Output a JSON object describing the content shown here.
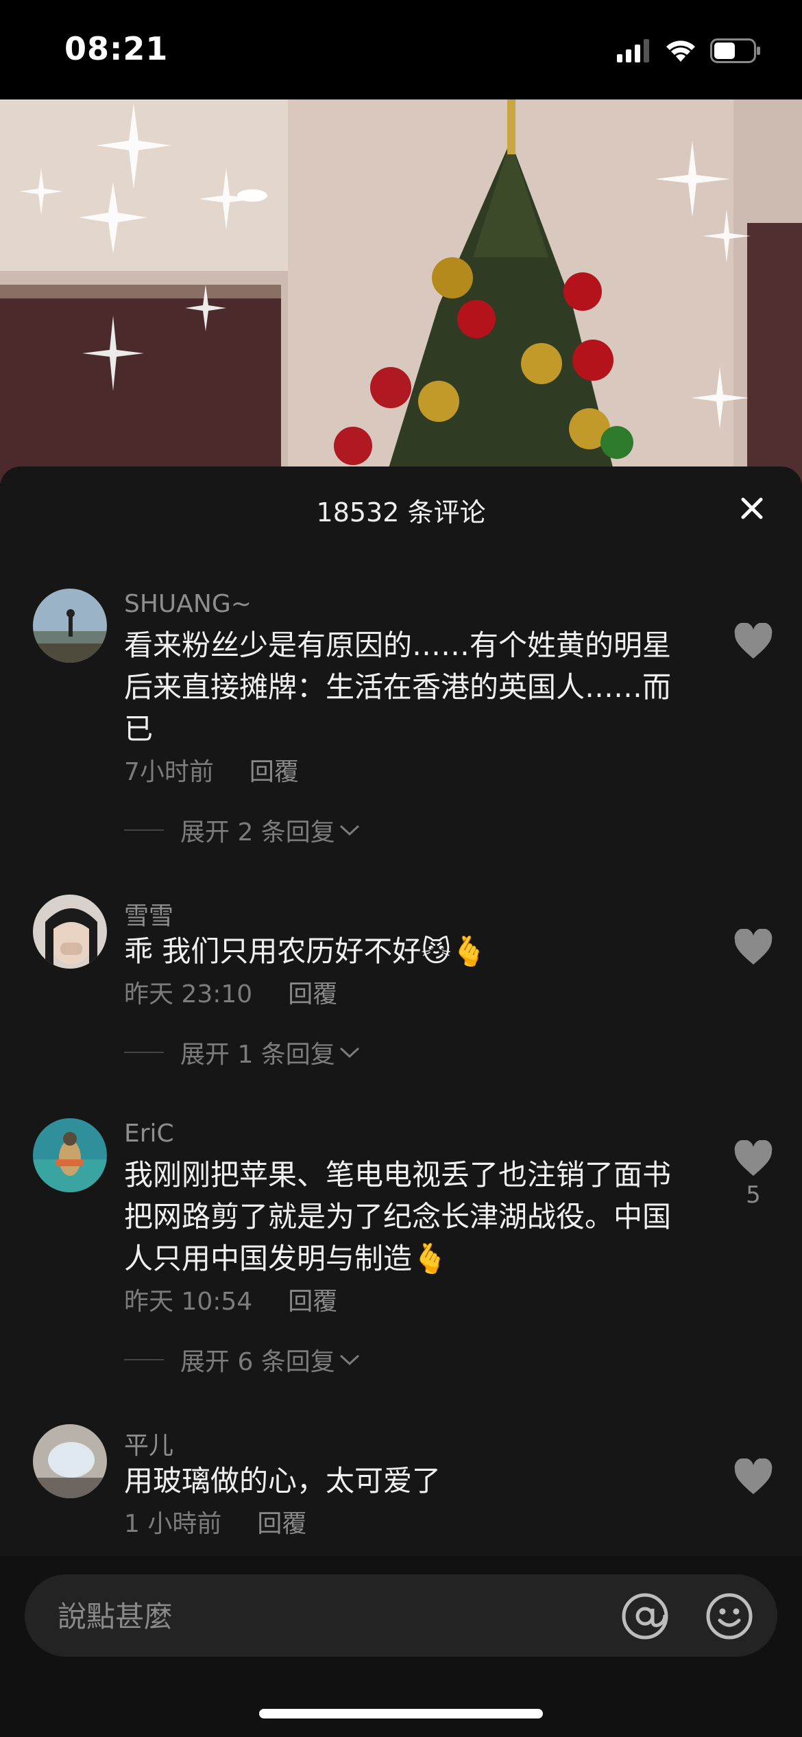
{
  "status_bar": {
    "time": "08:21",
    "icons": [
      "signal-icon",
      "wifi-icon",
      "battery-icon"
    ]
  },
  "video": {
    "description_icons": [
      "christmas-tree-image"
    ]
  },
  "panel": {
    "title": "18532 条评论",
    "close_icon": "close-icon"
  },
  "comments": [
    {
      "name": "SHUANG~",
      "text": "看来粉丝少是有原因的……有个姓黄的明星后来直接摊牌：生活在香港的英国人……而已",
      "time": "7小时前",
      "reply_label": "回覆",
      "expand_label": "展开 2 条回复",
      "likes": ""
    },
    {
      "name": "雪雪",
      "text": "乖 我们只用农历好不好😼🫰",
      "time": "昨天 23:10",
      "reply_label": "回覆",
      "expand_label": "展开 1 条回复",
      "likes": ""
    },
    {
      "name": "EriC",
      "text": "我刚刚把苹果、笔电电视丢了也注销了面书把网路剪了就是为了纪念长津湖战役。中国人只用中国发明与制造🫰",
      "time": "昨天 10:54",
      "reply_label": "回覆",
      "expand_label": "展开 6 条回复",
      "likes": "5"
    },
    {
      "name": "平儿",
      "text": "用玻璃做的心，太可爱了",
      "time": "1 小時前",
      "reply_label": "回覆",
      "expand_label": "",
      "likes": ""
    }
  ],
  "input": {
    "placeholder": "說點甚麼",
    "at_icon": "at-icon",
    "emoji_icon": "emoji-icon"
  },
  "colors": {
    "panel_bg": "#161616",
    "text_secondary": "#8e8e8e",
    "heart": "#8a8a8a"
  }
}
